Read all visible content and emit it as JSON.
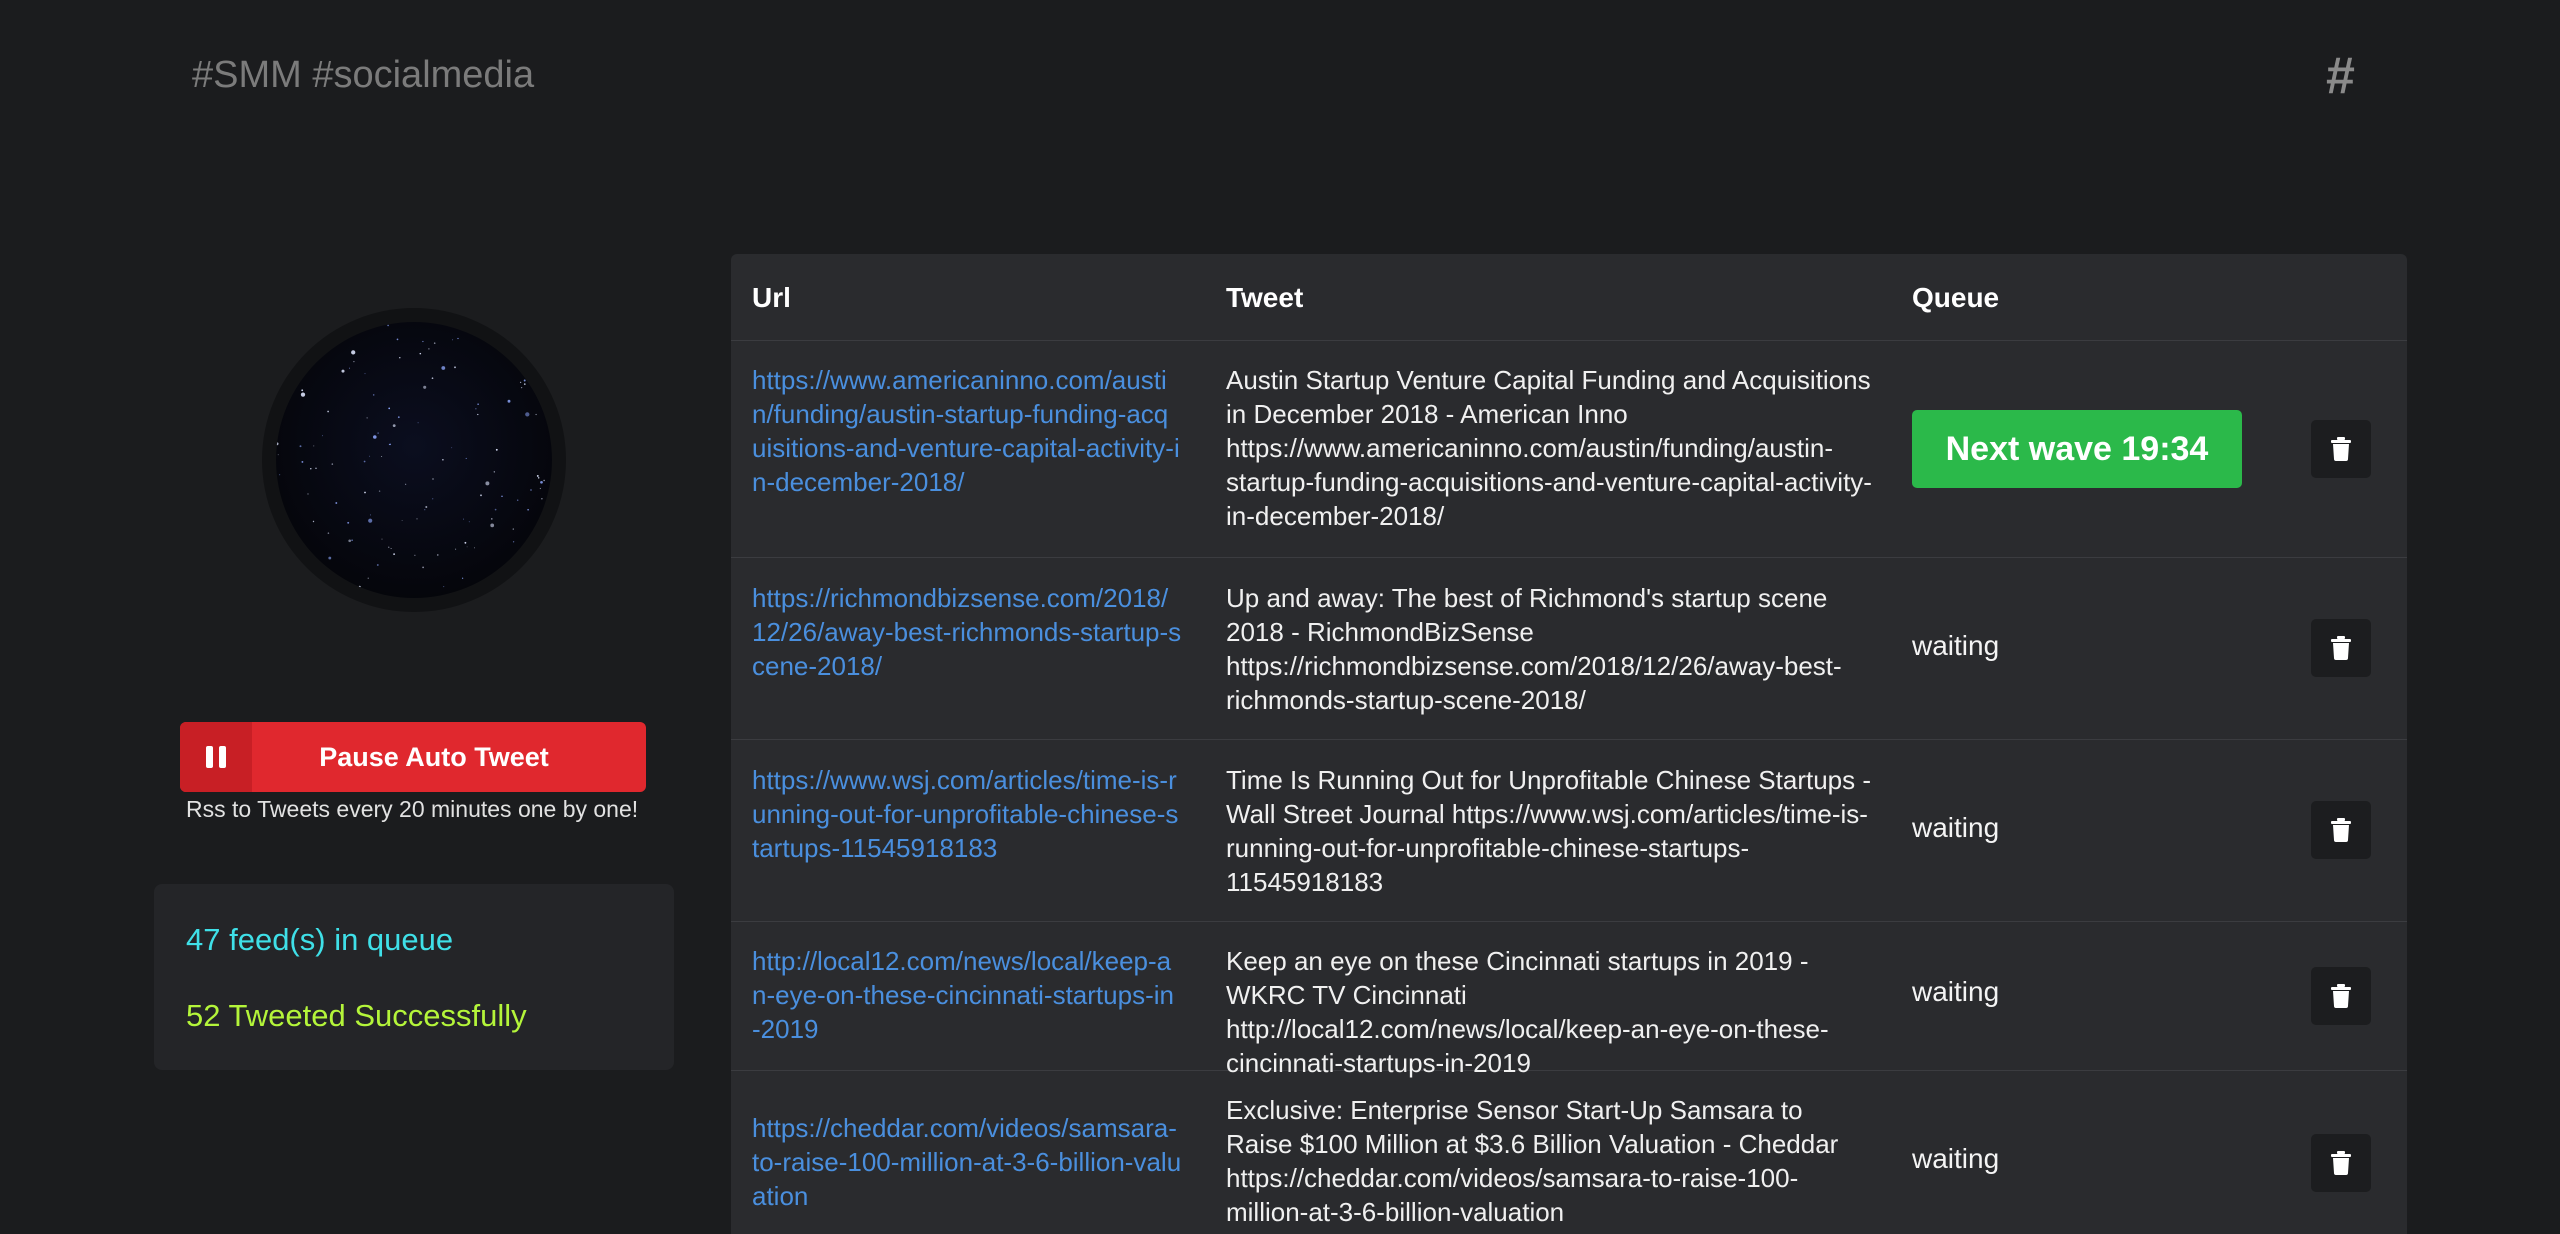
{
  "header": {
    "brand": "#SMM #socialmedia",
    "icon": "#"
  },
  "sidebar": {
    "pause_button_label": "Pause Auto Tweet",
    "note": "Rss to Tweets every 20 minutes one by one!",
    "stats": {
      "queue": "47 feed(s) in queue",
      "tweeted": "52 Tweeted Successfully"
    }
  },
  "table": {
    "columns": [
      "Url",
      "Tweet",
      "Queue"
    ],
    "rows": [
      {
        "url": "https://www.americaninno.com/austin/funding/austin-startup-funding-acquisitions-and-venture-capital-activity-in-december-2018/",
        "tweet": "Austin Startup Venture Capital Funding and Acquisitions in December 2018 - American Inno https://www.americaninno.com/austin/funding/austin-startup-funding-acquisitions-and-venture-capital-activity-in-december-2018/",
        "queue": "Next wave 19:34"
      },
      {
        "url": "https://richmondbizsense.com/2018/12/26/away-best-richmonds-startup-scene-2018/",
        "tweet": "Up and away: The best of Richmond's startup scene 2018 - RichmondBizSense https://richmondbizsense.com/2018/12/26/away-best-richmonds-startup-scene-2018/",
        "queue": "waiting"
      },
      {
        "url": "https://www.wsj.com/articles/time-is-running-out-for-unprofitable-chinese-startups-11545918183",
        "tweet": "Time Is Running Out for Unprofitable Chinese Startups - Wall Street Journal https://www.wsj.com/articles/time-is-running-out-for-unprofitable-chinese-startups-11545918183",
        "queue": "waiting"
      },
      {
        "url": "http://local12.com/news/local/keep-an-eye-on-these-cincinnati-startups-in-2019",
        "tweet": "Keep an eye on these Cincinnati startups in 2019 - WKRC TV Cincinnati http://local12.com/news/local/keep-an-eye-on-these-cincinnati-startups-in-2019",
        "queue": "waiting"
      },
      {
        "url": "https://cheddar.com/videos/samsara-to-raise-100-million-at-3-6-billion-valuation",
        "tweet": "Exclusive: Enterprise Sensor Start-Up Samsara to Raise $100 Million at $3.6 Billion Valuation - Cheddar https://cheddar.com/videos/samsara-to-raise-100-million-at-3-6-billion-valuation",
        "queue": "waiting"
      }
    ]
  }
}
